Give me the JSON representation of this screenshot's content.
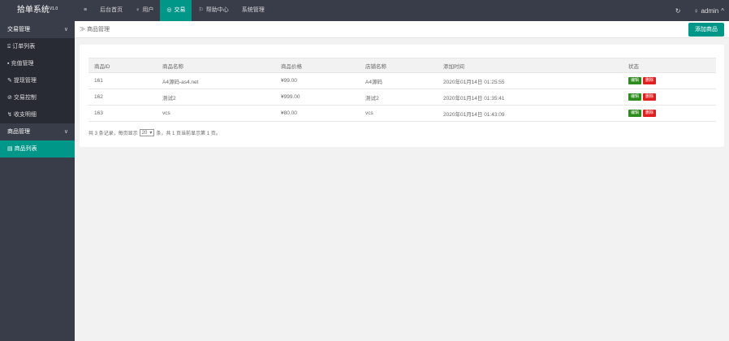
{
  "app": {
    "title": "拾单系统",
    "version": "V1.0"
  },
  "nav": [
    {
      "icon": "≡",
      "label": ""
    },
    {
      "icon": "",
      "label": "后台首页"
    },
    {
      "icon": "♀",
      "label": "用户"
    },
    {
      "icon": "◎",
      "label": "交易"
    },
    {
      "icon": "⚐",
      "label": "帮助中心"
    },
    {
      "icon": "",
      "label": "系统管理"
    }
  ],
  "top_right": {
    "refresh": "↻",
    "user": "admin",
    "user_icon": "♀",
    "caret": "^"
  },
  "sidebar": {
    "group1": "交易管理",
    "items1": [
      {
        "icon": "⌺",
        "label": "订单列表"
      },
      {
        "icon": "▪",
        "label": "充值管理"
      },
      {
        "icon": "✎",
        "label": "提现管理"
      },
      {
        "icon": "⊘",
        "label": "交易控制"
      },
      {
        "icon": "↯",
        "label": "收支明细"
      }
    ],
    "group2": "商品管理",
    "items2": [
      {
        "icon": "▤",
        "label": "商品列表"
      }
    ]
  },
  "breadcrumb": {
    "sep": "≫",
    "label": "商品管理"
  },
  "add_button": "添加商品",
  "table": {
    "headers": [
      "商品ID",
      "商品名称",
      "商品价格",
      "店铺名称",
      "添加时间",
      "状态"
    ],
    "rows": [
      [
        "161",
        "A4源码-as4.net",
        "¥99.00",
        "A4源码",
        "2020年01月14日 01:25:55"
      ],
      [
        "162",
        "测试2",
        "¥999.00",
        "测试2",
        "2020年01月14日 01:35:41"
      ],
      [
        "163",
        "vcs",
        "¥80.00",
        "vcs",
        "2020年01月14日 01:43:09"
      ]
    ],
    "edit_label": "编辑",
    "delete_label": "删除"
  },
  "pager": {
    "prefix": "共 3 条记录，每页显示",
    "per_page": "20",
    "caret": "▾",
    "suffix": "条，共 1 页当前显示第 1 页。"
  }
}
